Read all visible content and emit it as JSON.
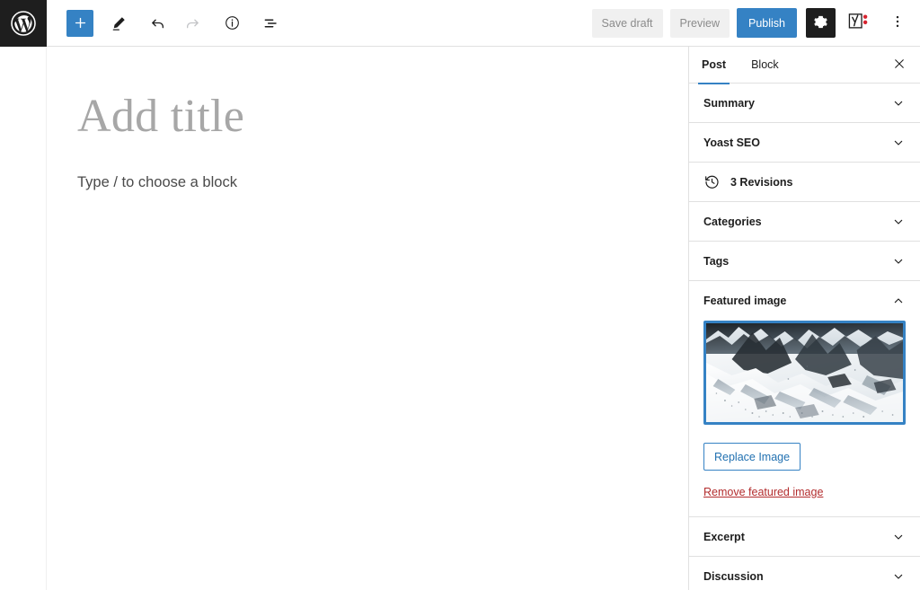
{
  "app": {
    "name": "WordPress Block Editor",
    "logo_icon": "wordpress-logo-icon",
    "accent_color": "#3582c4",
    "dark_color": "#1e1e1e",
    "danger_color": "#b32d2e"
  },
  "toolbar": {
    "left_tools": [
      {
        "name": "add-block-button",
        "icon": "plus-icon",
        "label": "Add block",
        "state": "active",
        "interactable": true
      },
      {
        "name": "tools-button",
        "icon": "pencil-icon",
        "label": "Tools",
        "state": "default",
        "interactable": true
      },
      {
        "name": "undo-button",
        "icon": "undo-arrow-icon",
        "label": "Undo",
        "state": "default",
        "interactable": true
      },
      {
        "name": "redo-button",
        "icon": "redo-arrow-icon",
        "label": "Redo",
        "state": "disabled",
        "interactable": false
      },
      {
        "name": "details-button",
        "icon": "info-circle-icon",
        "label": "Details",
        "state": "default",
        "interactable": true
      },
      {
        "name": "list-view-button",
        "icon": "list-view-icon",
        "label": "Document Overview",
        "state": "default",
        "interactable": true
      }
    ],
    "save_draft_label": "Save draft",
    "preview_label": "Preview",
    "publish_label": "Publish",
    "settings_icon": "gear-icon",
    "settings_label": "Settings",
    "yoast_icon": "yoast-seo-icon",
    "yoast_label": "Yoast SEO",
    "options_icon": "kebab-menu-icon",
    "options_label": "Options"
  },
  "editor": {
    "title_placeholder": "Add title",
    "paragraph_placeholder": "Type / to choose a block"
  },
  "sidebar": {
    "tabs": [
      {
        "label": "Post",
        "active": true
      },
      {
        "label": "Block",
        "active": false
      }
    ],
    "close_icon": "close-icon",
    "panels": [
      {
        "name": "summary",
        "label": "Summary",
        "expanded": false,
        "chevron": "chevron-down-icon"
      },
      {
        "name": "yoast-seo",
        "label": "Yoast SEO",
        "expanded": false,
        "chevron": "chevron-down-icon"
      },
      {
        "name": "revisions",
        "label": "3 Revisions",
        "icon": "revision-history-icon",
        "expanded": false,
        "chevron": ""
      },
      {
        "name": "categories",
        "label": "Categories",
        "expanded": false,
        "chevron": "chevron-down-icon"
      },
      {
        "name": "tags",
        "label": "Tags",
        "expanded": false,
        "chevron": "chevron-down-icon"
      }
    ],
    "featured_image": {
      "label": "Featured image",
      "expanded": true,
      "chevron": "chevron-up-icon",
      "thumbnail_alt": "Snowy mountain glacier with dark rocky peaks",
      "thumbnail_selected": true,
      "replace_label": "Replace Image",
      "remove_label": "Remove featured image"
    },
    "panels_after": [
      {
        "name": "excerpt",
        "label": "Excerpt",
        "expanded": false,
        "chevron": "chevron-down-icon"
      },
      {
        "name": "discussion",
        "label": "Discussion",
        "expanded": false,
        "chevron": "chevron-down-icon"
      }
    ]
  }
}
